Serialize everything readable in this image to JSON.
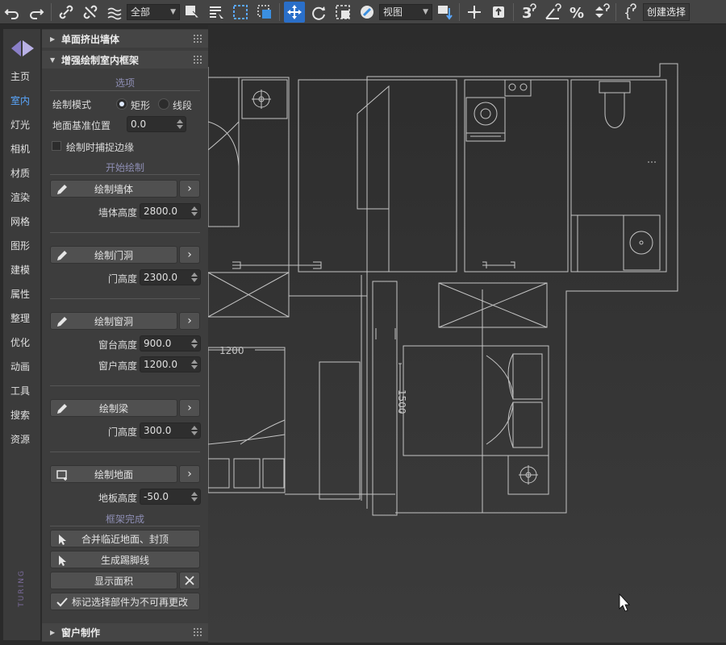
{
  "toolbar": {
    "selection_filter": "全部",
    "coord_system": "视图",
    "create_selection_label": "创建选择",
    "icons": [
      "undo-icon",
      "redo-icon",
      "link-icon",
      "unlink-icon",
      "bind-space-warp-icon",
      "select-object-icon",
      "select-by-name-icon",
      "rect-region-icon",
      "window-crossing-icon",
      "move-icon",
      "rotate-icon",
      "scale-icon",
      "placement-icon",
      "pivot-icon",
      "snap-icon",
      "pan-icon",
      "align-icon",
      "snap-3-icon",
      "angle-snap-icon",
      "percent-snap-icon",
      "spinner-snap-icon",
      "edit-named-sel-icon"
    ]
  },
  "rail": {
    "items": [
      "主页",
      "室内",
      "灯光",
      "相机",
      "材质",
      "渲染",
      "网格",
      "图形",
      "建模",
      "属性",
      "整理",
      "优化",
      "动画",
      "工具",
      "搜索",
      "资源"
    ],
    "active_index": 1,
    "brand": "TURING"
  },
  "panel": {
    "rollout_collapsed_top": "单面挤出墙体",
    "rollout_open": "增强绘制室内框架",
    "section_options": "选项",
    "draw_mode_label": "绘制模式",
    "mode_rect": "矩形",
    "mode_segment": "线段",
    "mode_selected": "矩形",
    "floor_base_label": "地面基准位置",
    "floor_base_value": "0.0",
    "snap_edge_label": "绘制时捕捉边缘",
    "snap_edge_checked": false,
    "section_start": "开始绘制",
    "draw_wall": "绘制墙体",
    "wall_height_label": "墙体高度",
    "wall_height_value": "2800.0",
    "draw_door": "绘制门洞",
    "door_height_label": "门高度",
    "door_height_value": "2300.0",
    "draw_window": "绘制窗洞",
    "sill_height_label": "窗台高度",
    "sill_height_value": "900.0",
    "window_height_label": "窗户高度",
    "window_height_value": "1200.0",
    "draw_beam": "绘制梁",
    "beam_height_label": "门高度",
    "beam_height_value": "300.0",
    "draw_floor": "绘制地面",
    "floor_height_label": "地板高度",
    "floor_height_value": "-50.0",
    "section_finish": "框架完成",
    "merge_floor": "合并临近地面、封顶",
    "gen_skirting": "生成踢脚线",
    "show_area": "显示面积",
    "mark_locked": "标记选择部件为不可再更改",
    "mark_locked_checked": true,
    "rollout_collapsed_bottom": "窗户制作"
  },
  "viewport": {
    "dimension_a": "1200",
    "dimension_b": "1500"
  },
  "colors": {
    "accent": "#2a6fc9",
    "rail_active": "#5aa7ff",
    "section": "#8e8eb4"
  }
}
